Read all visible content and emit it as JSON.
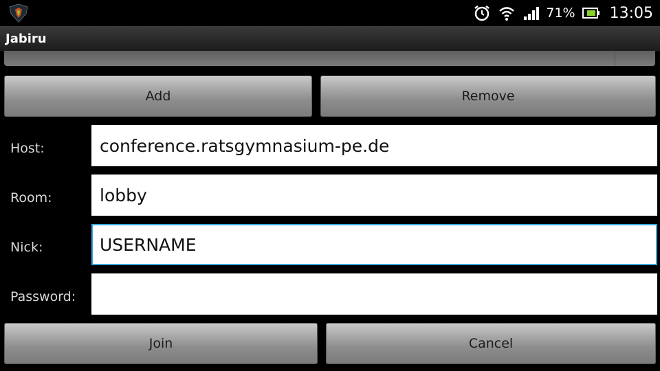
{
  "status_bar": {
    "battery_percent": "71%",
    "time": "13:05",
    "icons": [
      "app-logo-icon",
      "alarm-clock-icon",
      "wifi-icon",
      "signal-icon",
      "battery-icon"
    ]
  },
  "app": {
    "title": "Jabiru"
  },
  "list_buttons": {
    "add": "Add",
    "remove": "Remove"
  },
  "form": {
    "host": {
      "label": "Host:",
      "value": "conference.ratsgymnasium-pe.de"
    },
    "room": {
      "label": "Room:",
      "value": "lobby"
    },
    "nick": {
      "label": "Nick:",
      "value": "USERNAME"
    },
    "password": {
      "label": "Password:",
      "value": ""
    }
  },
  "actions": {
    "join": "Join",
    "cancel": "Cancel"
  },
  "colors": {
    "focus_border": "#39a6dd",
    "background": "#000000",
    "field": "#ffffff"
  }
}
